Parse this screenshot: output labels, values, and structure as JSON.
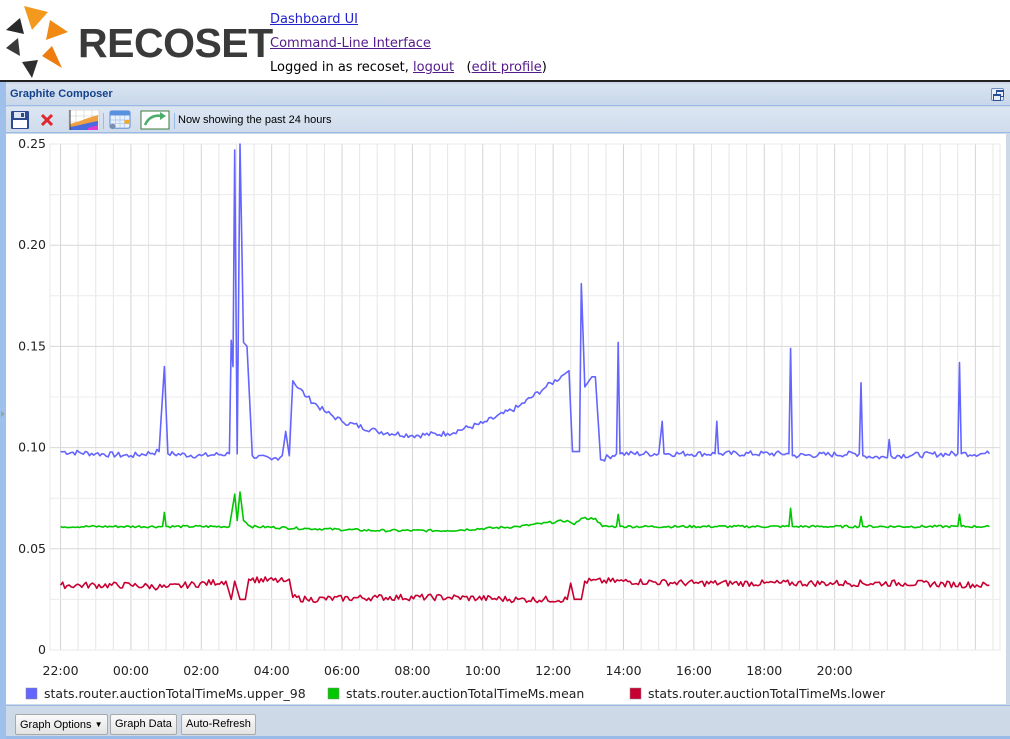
{
  "header": {
    "logo_text": "RECOSET",
    "nav_links": [
      {
        "label": "Dashboard UI"
      },
      {
        "label": "Command-Line Interface"
      }
    ],
    "login_prefix": "Logged in as recoset,",
    "logout_label": "logout",
    "edit_profile_open": "(",
    "edit_profile_label": "edit profile",
    "edit_profile_close": ")"
  },
  "panel": {
    "title": "Graphite Composer",
    "toolbar": {
      "status": "Now showing the past 24 hours",
      "buttons": [
        "save-icon",
        "delete-icon",
        "graph-options-icon",
        "calendar-icon",
        "time-range-icon"
      ]
    },
    "bottom_buttons": {
      "graph_options": "Graph Options",
      "graph_data": "Graph Data",
      "auto_refresh": "Auto-Refresh"
    }
  },
  "colors": {
    "upper_98": "#6464ff",
    "mean": "#00c800",
    "lower": "#c80032",
    "grid": "#e0e0e0",
    "panel_bg": "#cdd9e7",
    "panel_title": "#15428b"
  },
  "chart_data": {
    "type": "line",
    "title": "",
    "xlabel": "",
    "ylabel": "",
    "time_range": "past 24 hours",
    "x_range_hours": [
      -0.3,
      23.75
    ],
    "x_ticks": [
      "22:00",
      "00:00",
      "02:00",
      "04:00",
      "06:00",
      "08:00",
      "10:00",
      "12:00",
      "14:00",
      "16:00",
      "18:00",
      "20:00"
    ],
    "y_ticks": [
      "0",
      "0.05",
      "0.10",
      "0.15",
      "0.20",
      "0.25"
    ],
    "ylim": [
      0,
      0.25
    ],
    "grid": true,
    "legend_position": "bottom",
    "series": [
      {
        "name": "stats.router.auctionTotalTimeMs.upper_98",
        "color": "#6464ff",
        "points": [
          [
            0,
            0.098
          ],
          [
            1,
            0.097
          ],
          [
            2,
            0.096
          ],
          [
            2.8,
            0.098
          ],
          [
            2.95,
            0.14
          ],
          [
            3.05,
            0.097
          ],
          [
            4,
            0.096
          ],
          [
            4.8,
            0.097
          ],
          [
            4.85,
            0.153
          ],
          [
            4.9,
            0.14
          ],
          [
            4.95,
            0.247
          ],
          [
            5.02,
            0.097
          ],
          [
            5.1,
            0.25
          ],
          [
            5.2,
            0.152
          ],
          [
            5.3,
            0.15
          ],
          [
            5.45,
            0.096
          ],
          [
            6,
            0.094
          ],
          [
            6.3,
            0.096
          ],
          [
            6.4,
            0.108
          ],
          [
            6.5,
            0.096
          ],
          [
            6.6,
            0.133
          ],
          [
            7,
            0.125
          ],
          [
            7.5,
            0.118
          ],
          [
            8,
            0.113
          ],
          [
            9,
            0.108
          ],
          [
            10,
            0.106
          ],
          [
            11,
            0.107
          ],
          [
            12,
            0.112
          ],
          [
            13,
            0.12
          ],
          [
            13.8,
            0.13
          ],
          [
            14.3,
            0.136
          ],
          [
            14.45,
            0.138
          ],
          [
            14.55,
            0.098
          ],
          [
            14.75,
            0.098
          ],
          [
            14.8,
            0.181
          ],
          [
            14.9,
            0.13
          ],
          [
            15.1,
            0.135
          ],
          [
            15.2,
            0.135
          ],
          [
            15.35,
            0.094
          ],
          [
            15.8,
            0.097
          ],
          [
            15.85,
            0.152
          ],
          [
            15.9,
            0.097
          ],
          [
            17,
            0.097
          ],
          [
            17.1,
            0.113
          ],
          [
            17.15,
            0.097
          ],
          [
            18.6,
            0.097
          ],
          [
            18.65,
            0.113
          ],
          [
            18.7,
            0.097
          ],
          [
            20.7,
            0.097
          ],
          [
            20.75,
            0.149
          ],
          [
            20.8,
            0.096
          ],
          [
            22.7,
            0.097
          ],
          [
            22.75,
            0.132
          ],
          [
            22.8,
            0.096
          ],
          [
            23.5,
            0.095
          ],
          [
            23.55,
            0.104
          ],
          [
            23.6,
            0.096
          ],
          [
            25.5,
            0.097
          ],
          [
            25.55,
            0.142
          ],
          [
            25.6,
            0.097
          ],
          [
            26.4,
            0.097
          ]
        ]
      },
      {
        "name": "stats.router.auctionTotalTimeMs.mean",
        "color": "#00c800",
        "points": [
          [
            0,
            0.061
          ],
          [
            2.9,
            0.061
          ],
          [
            2.95,
            0.068
          ],
          [
            3.0,
            0.061
          ],
          [
            4.8,
            0.061
          ],
          [
            4.95,
            0.077
          ],
          [
            5.02,
            0.064
          ],
          [
            5.1,
            0.078
          ],
          [
            5.2,
            0.064
          ],
          [
            5.4,
            0.061
          ],
          [
            7,
            0.06
          ],
          [
            9,
            0.059
          ],
          [
            11,
            0.059
          ],
          [
            13,
            0.061
          ],
          [
            14.4,
            0.064
          ],
          [
            14.6,
            0.062
          ],
          [
            14.8,
            0.065
          ],
          [
            15.2,
            0.065
          ],
          [
            15.4,
            0.061
          ],
          [
            15.8,
            0.061
          ],
          [
            15.85,
            0.067
          ],
          [
            15.9,
            0.061
          ],
          [
            20.7,
            0.061
          ],
          [
            20.75,
            0.07
          ],
          [
            20.8,
            0.061
          ],
          [
            22.7,
            0.061
          ],
          [
            22.75,
            0.066
          ],
          [
            22.8,
            0.061
          ],
          [
            25.5,
            0.061
          ],
          [
            25.55,
            0.067
          ],
          [
            25.6,
            0.061
          ],
          [
            26.4,
            0.061
          ]
        ]
      },
      {
        "name": "stats.router.auctionTotalTimeMs.lower",
        "color": "#c80032",
        "points": [
          [
            0,
            0.032
          ],
          [
            2,
            0.032
          ],
          [
            3,
            0.031
          ],
          [
            4.7,
            0.034
          ],
          [
            4.85,
            0.025
          ],
          [
            4.95,
            0.034
          ],
          [
            5.1,
            0.025
          ],
          [
            5.25,
            0.025
          ],
          [
            5.35,
            0.035
          ],
          [
            6.4,
            0.034
          ],
          [
            6.5,
            0.035
          ],
          [
            6.6,
            0.026
          ],
          [
            7,
            0.025
          ],
          [
            9,
            0.026
          ],
          [
            11,
            0.026
          ],
          [
            13,
            0.025
          ],
          [
            14.4,
            0.025
          ],
          [
            14.5,
            0.033
          ],
          [
            14.6,
            0.025
          ],
          [
            14.8,
            0.025
          ],
          [
            14.9,
            0.034
          ],
          [
            16,
            0.034
          ],
          [
            18,
            0.033
          ],
          [
            20,
            0.033
          ],
          [
            22,
            0.033
          ],
          [
            24,
            0.033
          ],
          [
            26.4,
            0.032
          ]
        ]
      }
    ],
    "legend": [
      {
        "label": "stats.router.auctionTotalTimeMs.upper_98",
        "color": "#6464ff"
      },
      {
        "label": "stats.router.auctionTotalTimeMs.mean",
        "color": "#00c800"
      },
      {
        "label": "stats.router.auctionTotalTimeMs.lower",
        "color": "#c80032"
      }
    ]
  }
}
